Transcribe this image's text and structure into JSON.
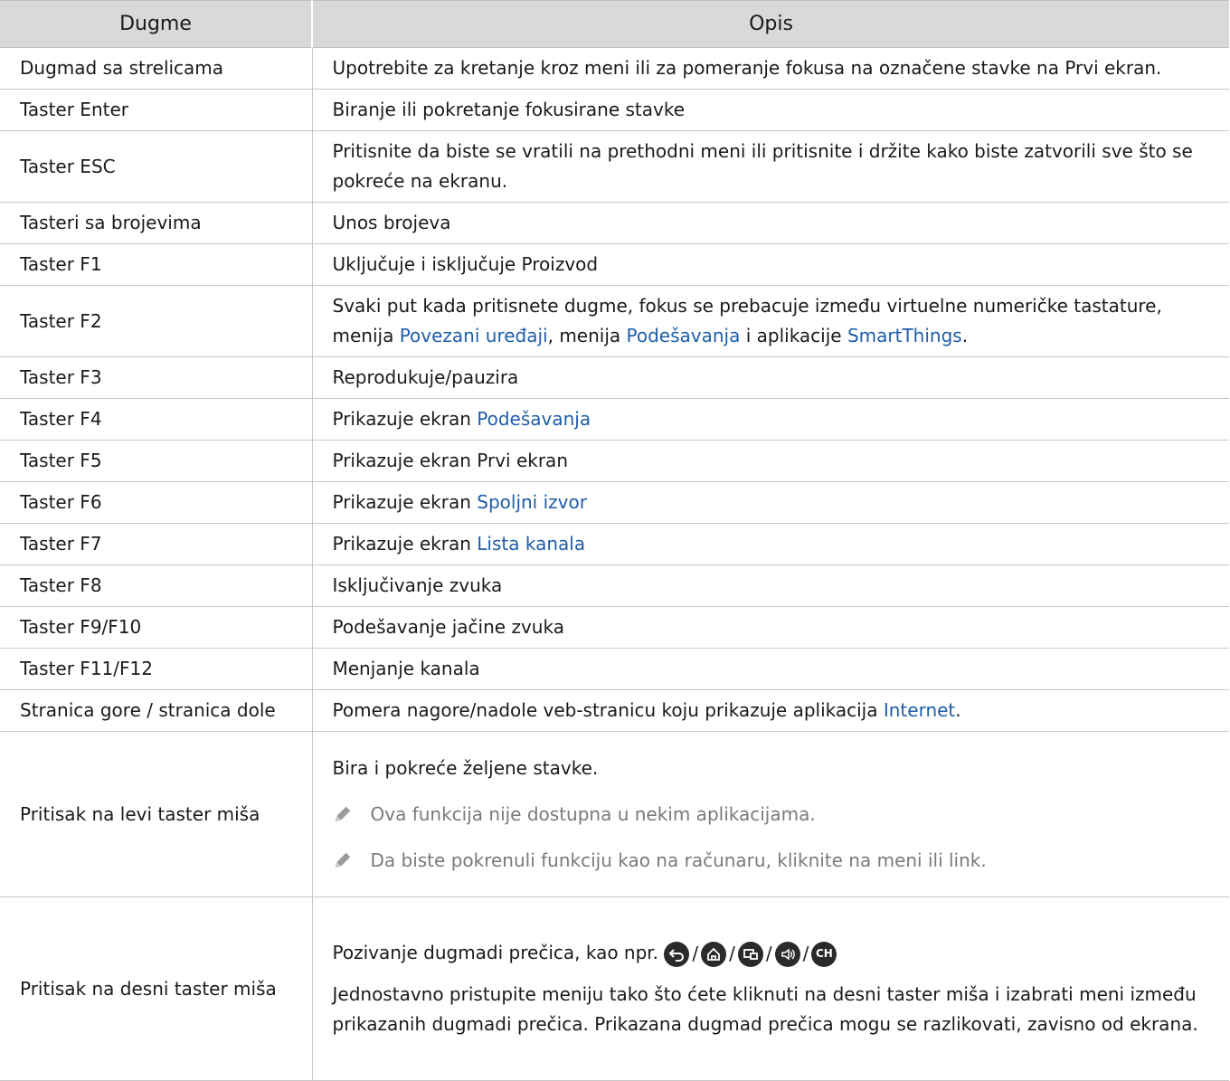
{
  "header": {
    "col1": "Dugme",
    "col2": "Opis"
  },
  "rows": [
    {
      "key": "Dugmad sa strelicama",
      "desc": "Upotrebite za kretanje kroz meni ili za pomeranje fokusa na označene stavke na Prvi ekran."
    },
    {
      "key": "Taster Enter",
      "desc": "Biranje ili pokretanje fokusirane stavke"
    },
    {
      "key": "Taster ESC",
      "desc": "Pritisnite da biste se vratili na prethodni meni ili pritisnite i držite kako biste zatvorili sve što se pokreće na ekranu."
    },
    {
      "key": "Tasteri sa brojevima",
      "desc": "Unos brojeva"
    },
    {
      "key": "Taster F1",
      "desc": "Uključuje i isključuje Proizvod"
    },
    {
      "key": "Taster F2",
      "desc_a": "Svaki put kada pritisnete dugme, fokus se prebacuje između virtuelne numeričke tastature, menija ",
      "link1": "Povezani uređaji",
      "desc_b": ", menija ",
      "link2": "Podešavanja",
      "desc_c": " i aplikacije ",
      "link3": "SmartThings",
      "desc_d": "."
    },
    {
      "key": "Taster F3",
      "desc": "Reprodukuje/pauzira"
    },
    {
      "key": "Taster F4",
      "desc": "Prikazuje ekran ",
      "link": "Podešavanja"
    },
    {
      "key": "Taster F5",
      "desc": "Prikazuje ekran Prvi ekran"
    },
    {
      "key": "Taster F6",
      "desc": "Prikazuje ekran ",
      "link": "Spoljni izvor"
    },
    {
      "key": "Taster F7",
      "desc": "Prikazuje ekran ",
      "link": "Lista kanala"
    },
    {
      "key": "Taster F8",
      "desc": "Isključivanje zvuka"
    },
    {
      "key": "Taster F9/F10",
      "desc": "Podešavanje jačine zvuka"
    },
    {
      "key": "Taster F11/F12",
      "desc": "Menjanje kanala"
    },
    {
      "key": "Stranica gore / stranica dole",
      "desc": "Pomera nagore/nadole veb-stranicu koju prikazuje aplikacija ",
      "link": "Internet",
      "desc_end": "."
    },
    {
      "key": "Pritisak na levi taster miša",
      "desc": "Bira i pokreće željene stavke.",
      "note1": "Ova funkcija nije dostupna u nekim aplikacijama.",
      "note2": "Da biste pokrenuli funkciju kao na računaru, kliknite na meni ili link."
    },
    {
      "key": "Pritisak na desni taster miša",
      "desc": "Pozivanje dugmadi prečica, kao npr. ",
      "ch_label": "CH",
      "desc2": "Jednostavno pristupite meniju tako što ćete kliknuti na desni taster miša i izabrati meni između prikazanih dugmadi prečica. Prikazana dugmad prečica mogu se razlikovati, zavisno od ekrana."
    }
  ],
  "icons": [
    "return-icon",
    "home-icon",
    "source-icon",
    "volume-icon",
    "channel-icon",
    "pencil-note-icon"
  ],
  "colors": {
    "header_bg": "#d9d9d9",
    "link": "#1f5ea8",
    "note_text": "#7a7a7a",
    "border": "#c8c8c8"
  }
}
